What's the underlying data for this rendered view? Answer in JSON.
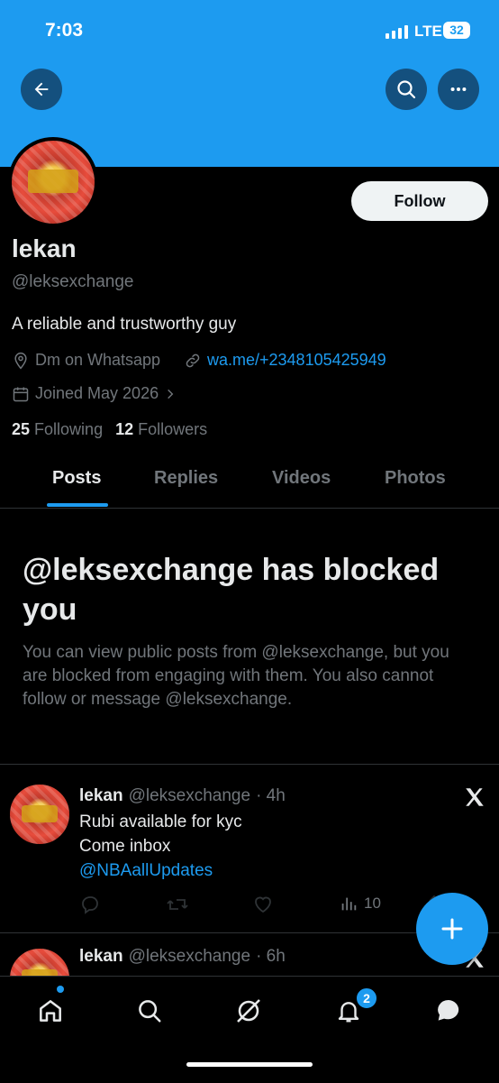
{
  "status_bar": {
    "time": "7:03",
    "network": "LTE",
    "battery": "32"
  },
  "profile": {
    "name": "lekan",
    "handle": "@leksexchange",
    "bio": "A reliable and trustworthy guy",
    "location": "Dm on Whatsapp",
    "website": "wa.me/+2348105425949",
    "joined": "Joined May 2026",
    "following_count": "25",
    "following_label": "Following",
    "followers_count": "12",
    "followers_label": "Followers",
    "follow_label": "Follow"
  },
  "tabs": [
    {
      "label": "Posts",
      "active": true
    },
    {
      "label": "Replies"
    },
    {
      "label": "Videos"
    },
    {
      "label": "Photos"
    }
  ],
  "blocked": {
    "title": "@leksexchange has blocked you",
    "text": "You can view public posts from @leksexchange, but you are blocked from engaging with them. You also cannot follow or message @leksexchange."
  },
  "posts": [
    {
      "name": "lekan",
      "handle": "@leksexchange",
      "time": "· 4h",
      "lines": [
        "Rubi available for kyc",
        "Come inbox"
      ],
      "mention": "@NBAallUpdates",
      "views": "10"
    },
    {
      "name": "lekan",
      "handle": "@leksexchange",
      "time": "· 6h"
    }
  ],
  "notifications_badge": "2",
  "colors": {
    "accent": "#1d9bf0",
    "background": "#000000",
    "muted": "#71767b",
    "text": "#e7e9ea"
  }
}
